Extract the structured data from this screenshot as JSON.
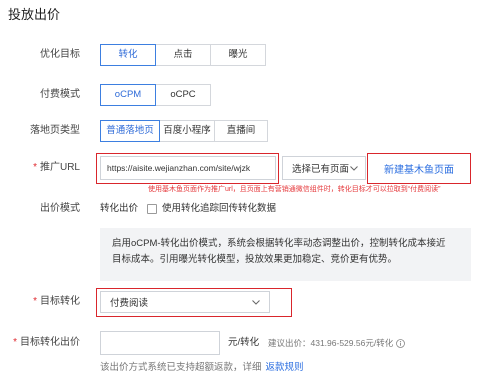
{
  "page": {
    "title": "投放出价"
  },
  "colors": {
    "accent": "#2f6bd8",
    "accent_border": "#3d7fe0",
    "link": "#2b6ee0",
    "highlight_red": "#d9262c",
    "hint_red": "#e5383b",
    "required_red": "#e0282e",
    "info_bg": "#f2f3f5"
  },
  "required_mark": "*",
  "form": {
    "optimize_goal": {
      "label": "优化目标",
      "options": [
        "转化",
        "点击",
        "曝光"
      ],
      "selected_index": 0
    },
    "pay_mode": {
      "label": "付费模式",
      "options": [
        "oCPM",
        "oCPC"
      ],
      "selected_index": 0
    },
    "landing_type": {
      "label": "落地页类型",
      "options": [
        "普通落地页",
        "百度小程序",
        "直播间"
      ],
      "selected_index": 0
    },
    "promo_url": {
      "label": "推广URL",
      "value": "https://aisite.wejianzhan.com/site/wjzk",
      "select_label": "选择已有页面",
      "create_link": "新建基木鱼页面",
      "hint": "使用基木鱼页面作为推广url，且页面上有营销通微信组件时，转化目标才可以拉取到“付费阅读”"
    },
    "bid_mode": {
      "label": "出价模式",
      "value": "转化出价",
      "checkbox_label": "使用转化追踪回传转化数据",
      "checked": false,
      "info": "启用oCPM-转化出价模式，系统会根据转化率动态调整出价，控制转化成本接近目标成本。引用曝光转化模型，投放效果更加稳定、竞价更有优势。"
    },
    "target_conversion": {
      "label": "目标转化",
      "value": "付费阅读"
    },
    "target_bid": {
      "label": "目标转化出价",
      "value": "",
      "unit": "元/转化",
      "suggestion": "建议出价：431.96-529.56元/转化"
    },
    "refund_note": {
      "text": "该出价方式系统已支持超额返款，详细",
      "link": "返款规则"
    }
  },
  "icons": {
    "select_chevron": "chevron-down-icon",
    "suggestion_info": "info-circle-icon"
  }
}
